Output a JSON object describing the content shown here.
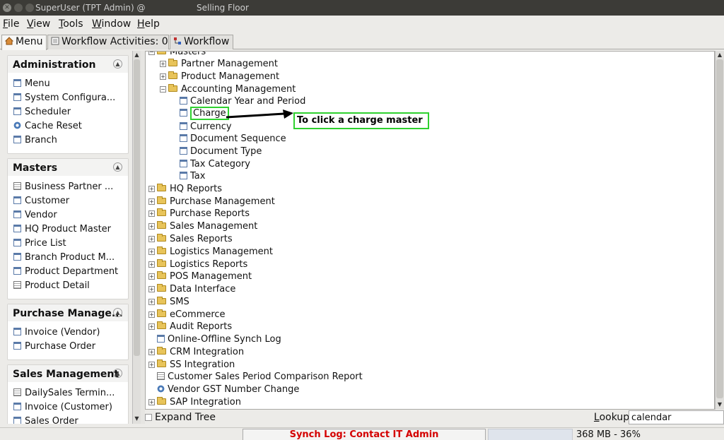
{
  "titlebar": {
    "app_title": "SuperUser (TPT Admin) @",
    "window_title": "Selling Floor"
  },
  "menubar": {
    "items": [
      "File",
      "View",
      "Tools",
      "Window",
      "Help"
    ]
  },
  "tabs": [
    {
      "label": "Menu",
      "icon": "home-icon"
    },
    {
      "label": "Workflow Activities: 0",
      "icon": "list-icon"
    },
    {
      "label": "Workflow",
      "icon": "workflow-icon"
    }
  ],
  "left_panel": {
    "groups": [
      {
        "title": "Administration",
        "items": [
          {
            "label": "Menu",
            "icon": "window-icon"
          },
          {
            "label": "System Configura...",
            "icon": "window-icon"
          },
          {
            "label": "Scheduler",
            "icon": "window-icon"
          },
          {
            "label": "Cache Reset",
            "icon": "process-icon"
          },
          {
            "label": "Branch",
            "icon": "window-icon"
          }
        ]
      },
      {
        "title": "Masters",
        "items": [
          {
            "label": "Business Partner ...",
            "icon": "report-icon"
          },
          {
            "label": "Customer",
            "icon": "window-icon"
          },
          {
            "label": "Vendor",
            "icon": "window-icon"
          },
          {
            "label": "HQ Product Master",
            "icon": "window-icon"
          },
          {
            "label": "Price List",
            "icon": "window-icon"
          },
          {
            "label": "Branch Product M...",
            "icon": "window-icon"
          },
          {
            "label": "Product Department",
            "icon": "window-icon"
          },
          {
            "label": "Product Detail",
            "icon": "report-icon"
          }
        ]
      },
      {
        "title": "Purchase Manage...",
        "items": [
          {
            "label": "Invoice (Vendor)",
            "icon": "window-icon"
          },
          {
            "label": "Purchase Order",
            "icon": "window-icon"
          }
        ]
      },
      {
        "title": "Sales Management",
        "items": [
          {
            "label": "DailySales Termin...",
            "icon": "report-icon"
          },
          {
            "label": "Invoice (Customer)",
            "icon": "window-icon"
          },
          {
            "label": "Sales Order",
            "icon": "window-icon"
          }
        ]
      }
    ]
  },
  "tree": {
    "rows": [
      {
        "label": "Masters",
        "type": "folder-open"
      },
      {
        "label": "Partner Management",
        "type": "folder"
      },
      {
        "label": "Product Management",
        "type": "folder"
      },
      {
        "label": "Accounting Management",
        "type": "folder-open"
      },
      {
        "label": "Calendar Year and Period",
        "type": "window"
      },
      {
        "label": "Charge",
        "type": "window"
      },
      {
        "label": "Currency",
        "type": "window"
      },
      {
        "label": "Document Sequence",
        "type": "window"
      },
      {
        "label": "Document Type",
        "type": "window"
      },
      {
        "label": "Tax Category",
        "type": "window"
      },
      {
        "label": "Tax",
        "type": "window"
      },
      {
        "label": "HQ Reports",
        "type": "folder"
      },
      {
        "label": "Purchase Management",
        "type": "folder"
      },
      {
        "label": "Purchase Reports",
        "type": "folder"
      },
      {
        "label": "Sales Management",
        "type": "folder"
      },
      {
        "label": "Sales Reports",
        "type": "folder"
      },
      {
        "label": "Logistics Management",
        "type": "folder"
      },
      {
        "label": "Logistics Reports",
        "type": "folder"
      },
      {
        "label": "POS Management",
        "type": "folder"
      },
      {
        "label": "Data Interface",
        "type": "folder"
      },
      {
        "label": "SMS",
        "type": "folder"
      },
      {
        "label": "eCommerce",
        "type": "folder"
      },
      {
        "label": "Audit Reports",
        "type": "folder"
      },
      {
        "label": "Online-Offline Synch Log",
        "type": "window"
      },
      {
        "label": "CRM Integration",
        "type": "folder"
      },
      {
        "label": "SS Integration",
        "type": "folder"
      },
      {
        "label": "Customer Sales Period Comparison Report",
        "type": "report"
      },
      {
        "label": "Vendor GST Number Change",
        "type": "process"
      },
      {
        "label": "SAP Integration",
        "type": "folder"
      }
    ],
    "annotation": "To click a charge  master"
  },
  "bottom": {
    "expand_label": "Expand Tree",
    "lookup_label": "Lookup",
    "lookup_value": "calendar"
  },
  "status": {
    "synch_text": "Synch Log: Contact IT Admin",
    "memory": "368 MB - 36%",
    "memory_percent": 36
  },
  "colors": {
    "highlight": "#2fd12f",
    "synch_text": "#d40000"
  }
}
